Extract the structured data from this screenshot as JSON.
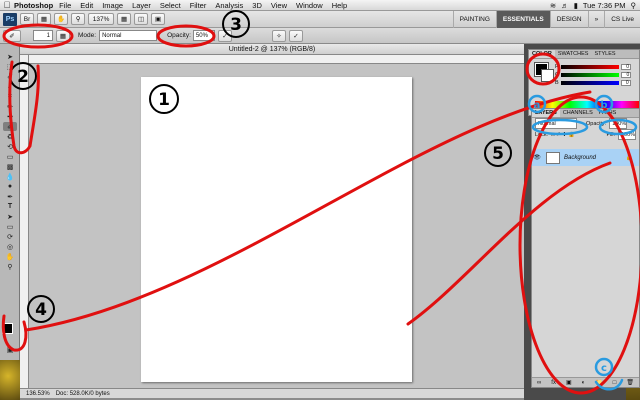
{
  "menubar": {
    "apple_icon": "apple-icon",
    "app_name": "Photoshop",
    "items": [
      "File",
      "Edit",
      "Image",
      "Layer",
      "Select",
      "Filter",
      "Analysis",
      "3D",
      "View",
      "Window",
      "Help"
    ],
    "clock": "Tue 7:36 PM"
  },
  "appbar": {
    "logo": "Ps",
    "zoom": "137%",
    "workspaces": [
      "PAINTING",
      "ESSENTIALS",
      "DESIGN",
      "»"
    ],
    "cs_live": "CS Live"
  },
  "options": {
    "brush_size": "1",
    "mode_label": "Mode:",
    "mode_value": "Normal",
    "opacity_label": "Opacity:",
    "opacity_value": "50%",
    "flow_label": "Flow:"
  },
  "document": {
    "title": "Untitled-2 @ 137% (RGB/8)"
  },
  "status": {
    "zoom": "136.53%",
    "doc": "Doc: 528.0K/0 bytes"
  },
  "color_panel": {
    "tabs": [
      "COLOR",
      "SWATCHES",
      "STYLES"
    ],
    "r_value": "0",
    "g_value": "0",
    "b_value": "0"
  },
  "layers_panel": {
    "tabs": [
      "LAYERS",
      "CHANNELS",
      "PATHS"
    ],
    "blend_mode": "Normal",
    "opacity_label": "Opacity:",
    "opacity_value": "100%",
    "lock_label": "Lock:",
    "fill_label": "Fill:",
    "fill_value": "100%",
    "layer_name": "Background"
  },
  "annotations": {
    "n1": "1",
    "n2": "2",
    "n3": "3",
    "n4": "4",
    "n5": "5",
    "a": "a",
    "b": "b",
    "c": "c",
    "red": "#e01010",
    "blue": "#2a9be0"
  }
}
